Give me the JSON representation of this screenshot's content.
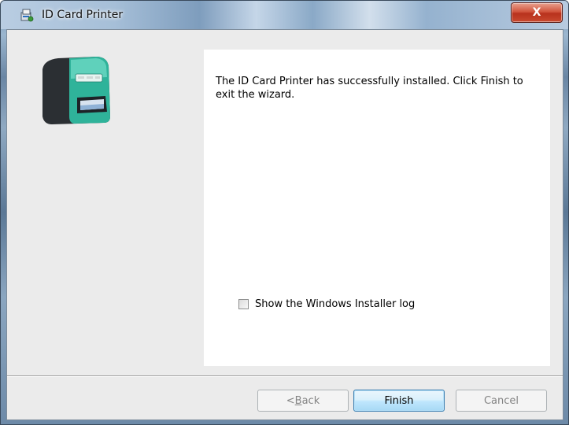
{
  "window": {
    "title": "ID Card Printer",
    "close_label": "X",
    "title_icon": "installer-icon"
  },
  "wizard": {
    "image": "id-card-printer-image",
    "message": "The ID Card Printer has successfully installed. Click Finish to exit the wizard.",
    "show_log_checkbox": {
      "label": "Show the Windows Installer log",
      "checked": false
    }
  },
  "buttons": {
    "back_prefix": "< ",
    "back_mnemonic": "B",
    "back_rest": "ack",
    "back_enabled": false,
    "finish": "Finish",
    "cancel": "Cancel",
    "cancel_enabled": false
  },
  "colors": {
    "accent_close": "#c9492f",
    "default_button_border": "#3c7fb1",
    "printer_teal": "#2fb39a"
  }
}
